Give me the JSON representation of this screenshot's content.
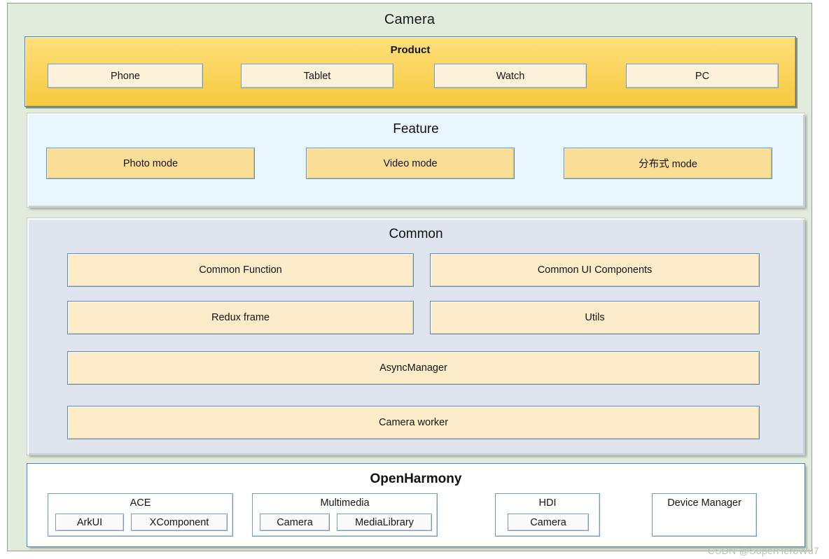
{
  "diagram": {
    "title": "Camera",
    "watermark": "CSDN @SuperHeroWu7",
    "layers": {
      "product": {
        "title": "Product",
        "items": [
          {
            "label": "Phone"
          },
          {
            "label": "Tablet"
          },
          {
            "label": "Watch"
          },
          {
            "label": "PC"
          }
        ]
      },
      "feature": {
        "title": "Feature",
        "items": [
          {
            "label": "Photo mode"
          },
          {
            "label": "Video mode"
          },
          {
            "label": "分布式 mode"
          }
        ]
      },
      "common": {
        "title": "Common",
        "items": [
          {
            "label": "Common Function"
          },
          {
            "label": "Common UI Components"
          },
          {
            "label": "Redux frame"
          },
          {
            "label": "Utils"
          },
          {
            "label": "AsyncManager"
          },
          {
            "label": "Camera worker"
          }
        ]
      },
      "openharmony": {
        "title": "OpenHarmony",
        "groups": [
          {
            "title": "ACE",
            "chips": [
              "ArkUI",
              "XComponent"
            ]
          },
          {
            "title": "Multimedia",
            "chips": [
              "Camera",
              "MediaLibrary"
            ]
          },
          {
            "title": "HDI",
            "chips": [
              "Camera"
            ]
          },
          {
            "title": "Device Manager",
            "chips": []
          }
        ]
      }
    },
    "colors": {
      "outer_bg": "#e2ecdc",
      "product_bg": "#f6c93f",
      "feature_bg": "#eaf6fd",
      "common_bg": "#dfe4ef",
      "harmony_bg": "#ffffff",
      "item_cream": "#fcecc9",
      "item_yellow": "#fbde96",
      "border_blue": "#5b8db8"
    }
  }
}
